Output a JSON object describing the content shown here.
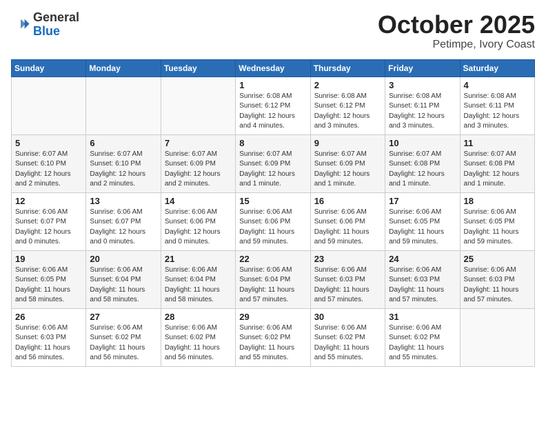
{
  "header": {
    "logo_general": "General",
    "logo_blue": "Blue",
    "month_title": "October 2025",
    "location": "Petimpe, Ivory Coast"
  },
  "days_of_week": [
    "Sunday",
    "Monday",
    "Tuesday",
    "Wednesday",
    "Thursday",
    "Friday",
    "Saturday"
  ],
  "weeks": [
    [
      {
        "day": "",
        "info": ""
      },
      {
        "day": "",
        "info": ""
      },
      {
        "day": "",
        "info": ""
      },
      {
        "day": "1",
        "info": "Sunrise: 6:08 AM\nSunset: 6:12 PM\nDaylight: 12 hours and 4 minutes."
      },
      {
        "day": "2",
        "info": "Sunrise: 6:08 AM\nSunset: 6:12 PM\nDaylight: 12 hours and 3 minutes."
      },
      {
        "day": "3",
        "info": "Sunrise: 6:08 AM\nSunset: 6:11 PM\nDaylight: 12 hours and 3 minutes."
      },
      {
        "day": "4",
        "info": "Sunrise: 6:08 AM\nSunset: 6:11 PM\nDaylight: 12 hours and 3 minutes."
      }
    ],
    [
      {
        "day": "5",
        "info": "Sunrise: 6:07 AM\nSunset: 6:10 PM\nDaylight: 12 hours and 2 minutes."
      },
      {
        "day": "6",
        "info": "Sunrise: 6:07 AM\nSunset: 6:10 PM\nDaylight: 12 hours and 2 minutes."
      },
      {
        "day": "7",
        "info": "Sunrise: 6:07 AM\nSunset: 6:09 PM\nDaylight: 12 hours and 2 minutes."
      },
      {
        "day": "8",
        "info": "Sunrise: 6:07 AM\nSunset: 6:09 PM\nDaylight: 12 hours and 1 minute."
      },
      {
        "day": "9",
        "info": "Sunrise: 6:07 AM\nSunset: 6:09 PM\nDaylight: 12 hours and 1 minute."
      },
      {
        "day": "10",
        "info": "Sunrise: 6:07 AM\nSunset: 6:08 PM\nDaylight: 12 hours and 1 minute."
      },
      {
        "day": "11",
        "info": "Sunrise: 6:07 AM\nSunset: 6:08 PM\nDaylight: 12 hours and 1 minute."
      }
    ],
    [
      {
        "day": "12",
        "info": "Sunrise: 6:06 AM\nSunset: 6:07 PM\nDaylight: 12 hours and 0 minutes."
      },
      {
        "day": "13",
        "info": "Sunrise: 6:06 AM\nSunset: 6:07 PM\nDaylight: 12 hours and 0 minutes."
      },
      {
        "day": "14",
        "info": "Sunrise: 6:06 AM\nSunset: 6:06 PM\nDaylight: 12 hours and 0 minutes."
      },
      {
        "day": "15",
        "info": "Sunrise: 6:06 AM\nSunset: 6:06 PM\nDaylight: 11 hours and 59 minutes."
      },
      {
        "day": "16",
        "info": "Sunrise: 6:06 AM\nSunset: 6:06 PM\nDaylight: 11 hours and 59 minutes."
      },
      {
        "day": "17",
        "info": "Sunrise: 6:06 AM\nSunset: 6:05 PM\nDaylight: 11 hours and 59 minutes."
      },
      {
        "day": "18",
        "info": "Sunrise: 6:06 AM\nSunset: 6:05 PM\nDaylight: 11 hours and 59 minutes."
      }
    ],
    [
      {
        "day": "19",
        "info": "Sunrise: 6:06 AM\nSunset: 6:05 PM\nDaylight: 11 hours and 58 minutes."
      },
      {
        "day": "20",
        "info": "Sunrise: 6:06 AM\nSunset: 6:04 PM\nDaylight: 11 hours and 58 minutes."
      },
      {
        "day": "21",
        "info": "Sunrise: 6:06 AM\nSunset: 6:04 PM\nDaylight: 11 hours and 58 minutes."
      },
      {
        "day": "22",
        "info": "Sunrise: 6:06 AM\nSunset: 6:04 PM\nDaylight: 11 hours and 57 minutes."
      },
      {
        "day": "23",
        "info": "Sunrise: 6:06 AM\nSunset: 6:03 PM\nDaylight: 11 hours and 57 minutes."
      },
      {
        "day": "24",
        "info": "Sunrise: 6:06 AM\nSunset: 6:03 PM\nDaylight: 11 hours and 57 minutes."
      },
      {
        "day": "25",
        "info": "Sunrise: 6:06 AM\nSunset: 6:03 PM\nDaylight: 11 hours and 57 minutes."
      }
    ],
    [
      {
        "day": "26",
        "info": "Sunrise: 6:06 AM\nSunset: 6:03 PM\nDaylight: 11 hours and 56 minutes."
      },
      {
        "day": "27",
        "info": "Sunrise: 6:06 AM\nSunset: 6:02 PM\nDaylight: 11 hours and 56 minutes."
      },
      {
        "day": "28",
        "info": "Sunrise: 6:06 AM\nSunset: 6:02 PM\nDaylight: 11 hours and 56 minutes."
      },
      {
        "day": "29",
        "info": "Sunrise: 6:06 AM\nSunset: 6:02 PM\nDaylight: 11 hours and 55 minutes."
      },
      {
        "day": "30",
        "info": "Sunrise: 6:06 AM\nSunset: 6:02 PM\nDaylight: 11 hours and 55 minutes."
      },
      {
        "day": "31",
        "info": "Sunrise: 6:06 AM\nSunset: 6:02 PM\nDaylight: 11 hours and 55 minutes."
      },
      {
        "day": "",
        "info": ""
      }
    ]
  ]
}
